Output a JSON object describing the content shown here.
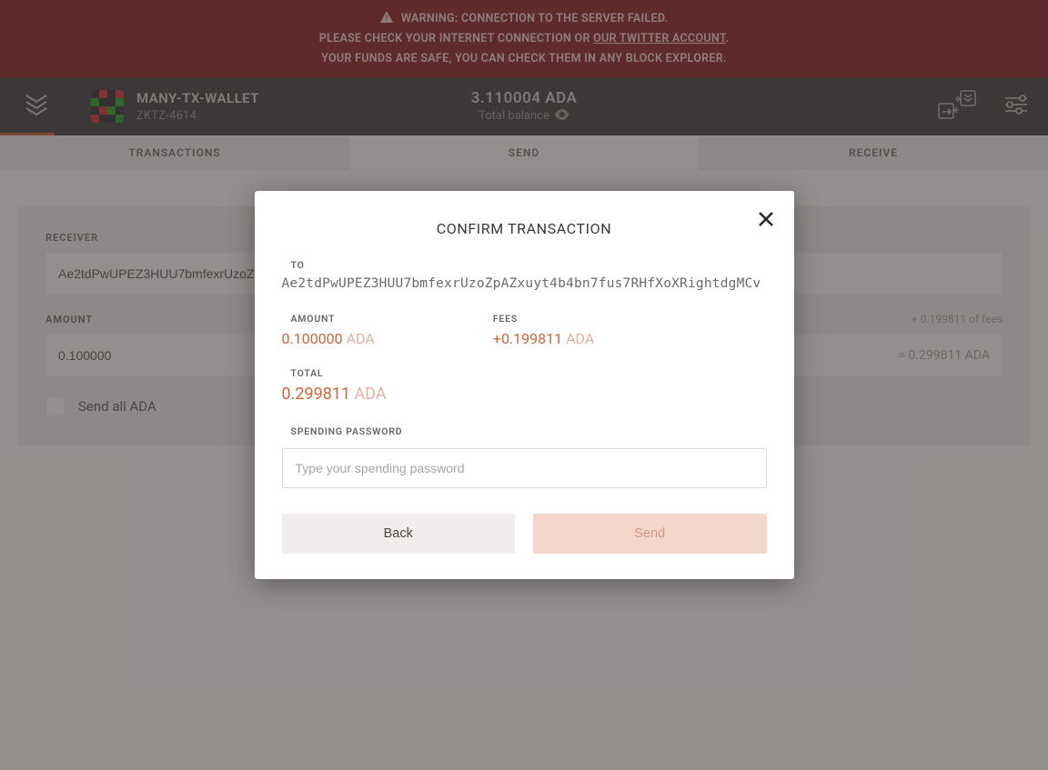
{
  "warning": {
    "line1": "WARNING: CONNECTION TO THE SERVER FAILED.",
    "line2a": "PLEASE CHECK YOUR INTERNET CONNECTION OR ",
    "twitter_link": "OUR TWITTER ACCOUNT",
    "line2b": ".",
    "line3": "YOUR FUNDS ARE SAFE, YOU CAN CHECK THEM IN ANY BLOCK EXPLORER."
  },
  "header": {
    "wallet_name": "MANY-TX-WALLET",
    "wallet_id": "ZKTZ-4614",
    "balance": "3.110004 ADA",
    "balance_label": "Total balance"
  },
  "tabs": {
    "transactions": "TRANSACTIONS",
    "send": "SEND",
    "receive": "RECEIVE"
  },
  "send_form": {
    "receiver_label": "RECEIVER",
    "receiver_value": "Ae2tdPwUPEZ3HUU7bmfexrUzoZ",
    "amount_label": "AMOUNT",
    "amount_value": "0.100000",
    "fees_note": "+ 0.199811 of fees",
    "total_inside": "= 0.299811 ADA",
    "send_all_label": "Send all ADA"
  },
  "modal": {
    "title": "CONFIRM TRANSACTION",
    "to_label": "TO",
    "to_address": "Ae2tdPwUPEZ3HUU7bmfexrUzoZpAZxuyt4b4bn7fus7RHfXoXRightdgMCv",
    "amount_label": "AMOUNT",
    "amount_value": "0.100000",
    "amount_currency": "ADA",
    "fees_label": "FEES",
    "fees_value": "+0.199811",
    "fees_currency": "ADA",
    "total_label": "TOTAL",
    "total_value": "0.299811",
    "total_currency": "ADA",
    "password_label": "SPENDING PASSWORD",
    "password_placeholder": "Type your spending password",
    "back_label": "Back",
    "send_label": "Send"
  }
}
